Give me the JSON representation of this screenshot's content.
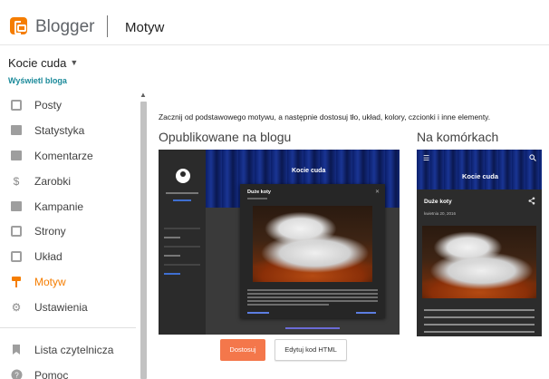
{
  "header": {
    "brand": "Blogger",
    "page_title": "Motyw"
  },
  "sidebar": {
    "blog_name": "Kocie cuda",
    "view_blog": "Wyświetl bloga",
    "items": [
      {
        "label": "Posty",
        "icon": "posts-icon"
      },
      {
        "label": "Statystyka",
        "icon": "stats-icon"
      },
      {
        "label": "Komentarze",
        "icon": "comments-icon"
      },
      {
        "label": "Zarobki",
        "icon": "dollar-icon"
      },
      {
        "label": "Kampanie",
        "icon": "campaigns-icon"
      },
      {
        "label": "Strony",
        "icon": "pages-icon"
      },
      {
        "label": "Układ",
        "icon": "layout-icon"
      },
      {
        "label": "Motyw",
        "icon": "theme-brush-icon",
        "active": true
      },
      {
        "label": "Ustawienia",
        "icon": "gear-icon"
      },
      {
        "label": "Lista czytelnicza",
        "icon": "bookmark-icon"
      },
      {
        "label": "Pomoc",
        "icon": "help-icon"
      }
    ]
  },
  "main": {
    "hint": "Zacznij od podstawowego motywu, a następnie dostosuj tło, układ, kolory, czcionki i inne elementy.",
    "live_heading": "Opublikowane na blogu",
    "mobile_heading": "Na komórkach",
    "desktop_preview": {
      "blog_title": "Kocie cuda",
      "post_title": "Duże koty"
    },
    "mobile_preview": {
      "blog_title": "Kocie cuda",
      "post_title": "Duże koty",
      "post_date": "kwietnia 20, 2016"
    },
    "customize_label": "Dostosuj",
    "edit_html_label": "Edytuj kod HTML"
  },
  "colors": {
    "accent": "#f57d00",
    "customize_button": "#f4774b",
    "link": "#1b8a9a"
  }
}
